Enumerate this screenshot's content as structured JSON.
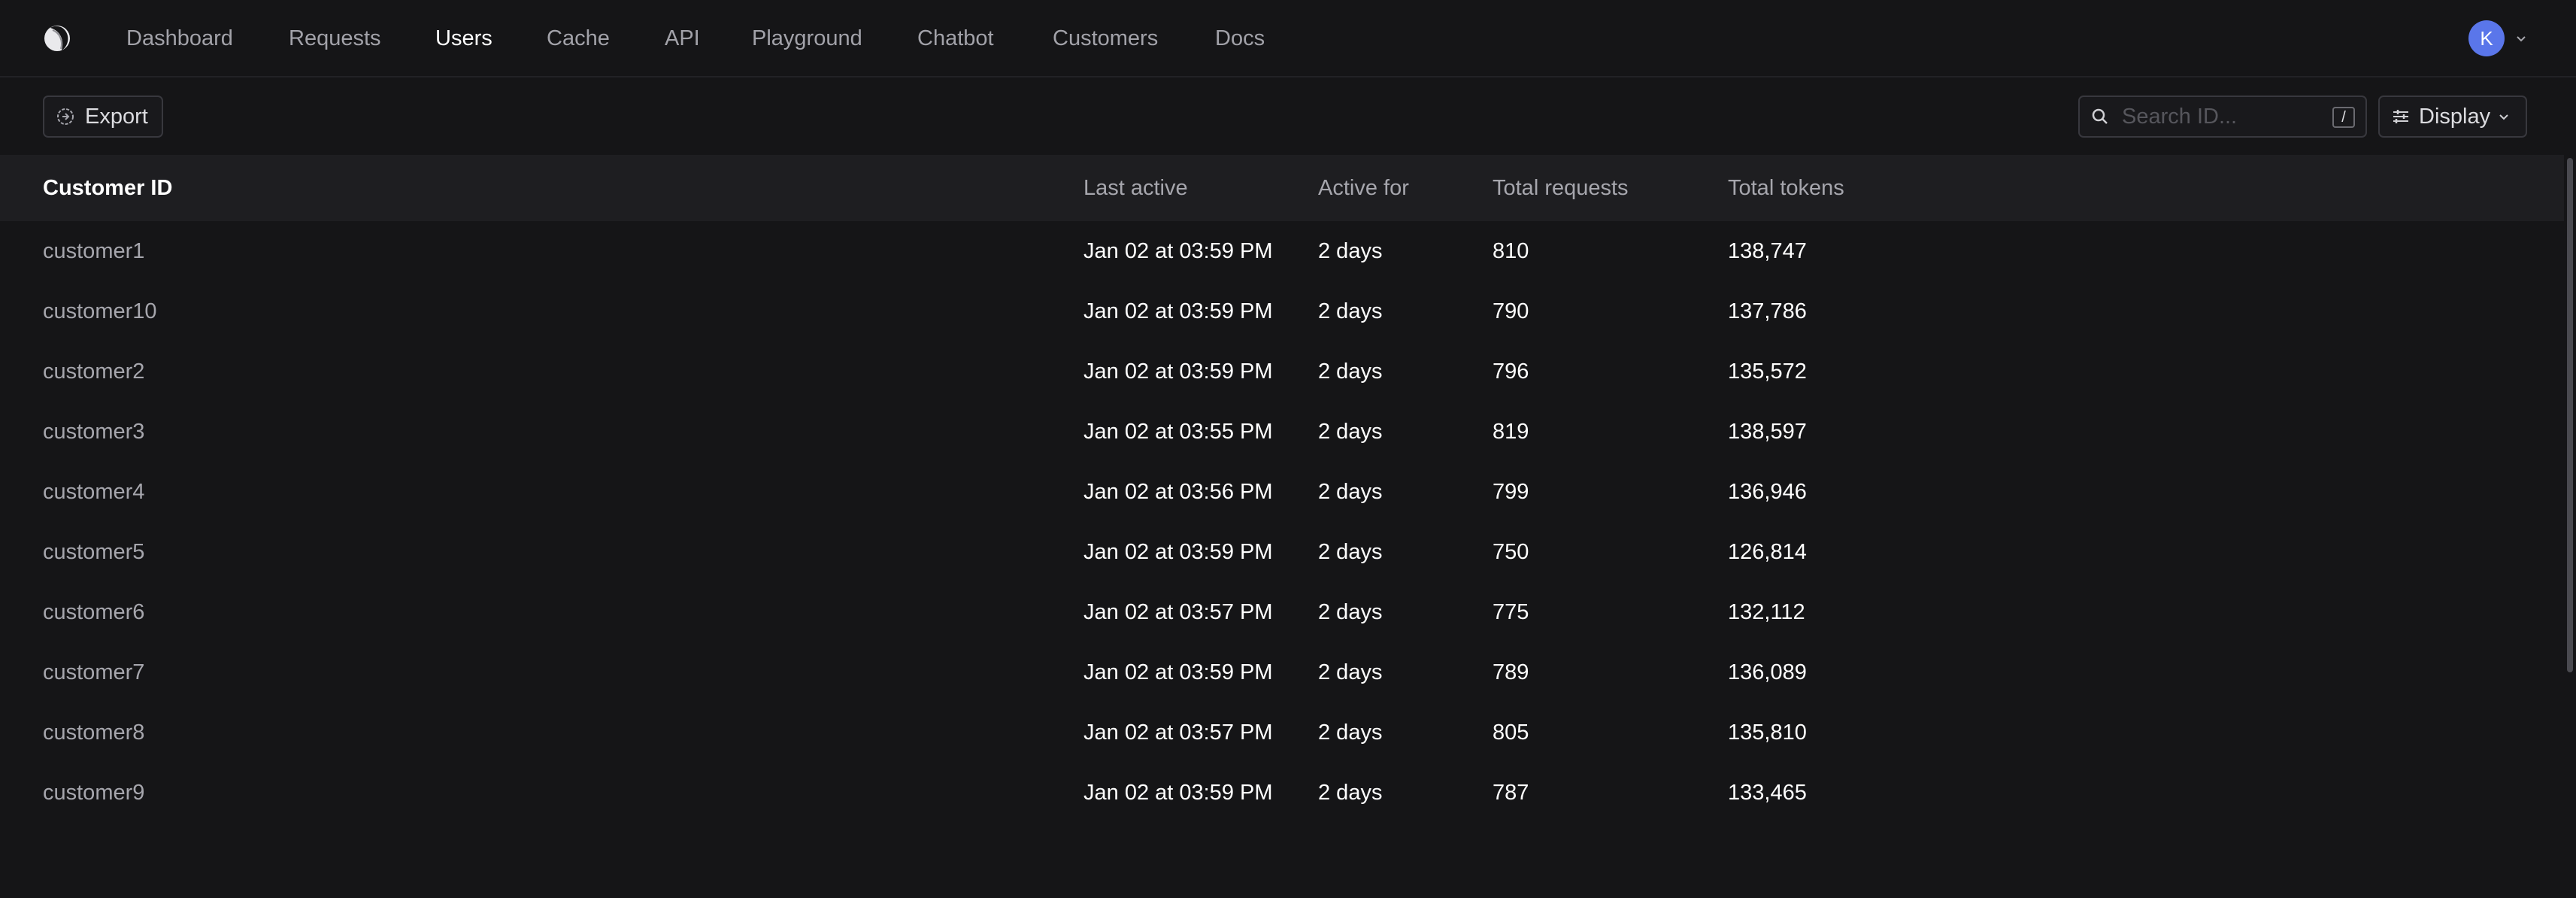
{
  "nav": {
    "items": [
      {
        "label": "Dashboard"
      },
      {
        "label": "Requests"
      },
      {
        "label": "Users",
        "active": true
      },
      {
        "label": "Cache"
      },
      {
        "label": "API"
      },
      {
        "label": "Playground"
      },
      {
        "label": "Chatbot"
      },
      {
        "label": "Customers"
      },
      {
        "label": "Docs"
      }
    ],
    "avatar_initial": "K",
    "avatar_color": "#5a76ea"
  },
  "toolbar": {
    "export_label": "Export",
    "search_placeholder": "Search ID...",
    "search_value": "",
    "search_shortcut": "/",
    "display_label": "Display"
  },
  "table": {
    "columns": [
      "Customer ID",
      "Last active",
      "Active for",
      "Total requests",
      "Total tokens"
    ],
    "rows": [
      {
        "id": "customer1",
        "last_active": "Jan 02 at 03:59 PM",
        "active_for": "2 days",
        "requests": "810",
        "tokens": "138,747"
      },
      {
        "id": "customer10",
        "last_active": "Jan 02 at 03:59 PM",
        "active_for": "2 days",
        "requests": "790",
        "tokens": "137,786"
      },
      {
        "id": "customer2",
        "last_active": "Jan 02 at 03:59 PM",
        "active_for": "2 days",
        "requests": "796",
        "tokens": "135,572"
      },
      {
        "id": "customer3",
        "last_active": "Jan 02 at 03:55 PM",
        "active_for": "2 days",
        "requests": "819",
        "tokens": "138,597"
      },
      {
        "id": "customer4",
        "last_active": "Jan 02 at 03:56 PM",
        "active_for": "2 days",
        "requests": "799",
        "tokens": "136,946"
      },
      {
        "id": "customer5",
        "last_active": "Jan 02 at 03:59 PM",
        "active_for": "2 days",
        "requests": "750",
        "tokens": "126,814"
      },
      {
        "id": "customer6",
        "last_active": "Jan 02 at 03:57 PM",
        "active_for": "2 days",
        "requests": "775",
        "tokens": "132,112"
      },
      {
        "id": "customer7",
        "last_active": "Jan 02 at 03:59 PM",
        "active_for": "2 days",
        "requests": "789",
        "tokens": "136,089"
      },
      {
        "id": "customer8",
        "last_active": "Jan 02 at 03:57 PM",
        "active_for": "2 days",
        "requests": "805",
        "tokens": "135,810"
      },
      {
        "id": "customer9",
        "last_active": "Jan 02 at 03:59 PM",
        "active_for": "2 days",
        "requests": "787",
        "tokens": "133,465"
      }
    ]
  },
  "icons": {
    "logo": "app-logo-icon",
    "export": "export-icon",
    "search": "search-icon",
    "display": "sliders-icon",
    "chevron": "chevron-down-icon"
  },
  "colors": {
    "background": "#151517",
    "header_row": "#1e1e21",
    "muted_text": "#a6a6ad",
    "border": "#38383e"
  }
}
